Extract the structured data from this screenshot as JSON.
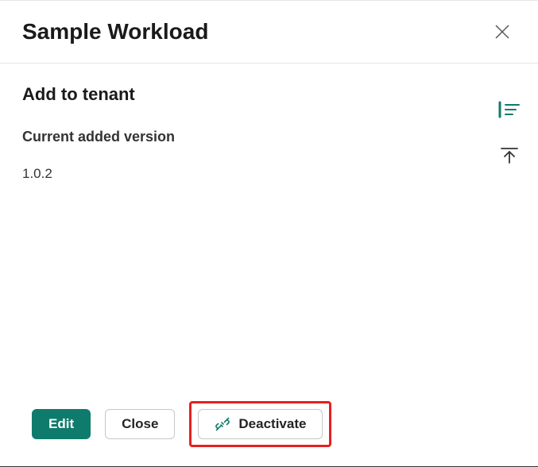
{
  "header": {
    "title": "Sample Workload"
  },
  "body": {
    "section_title": "Add to tenant",
    "version_label": "Current added version",
    "version_value": "1.0.2"
  },
  "footer": {
    "edit_label": "Edit",
    "close_label": "Close",
    "deactivate_label": "Deactivate"
  },
  "colors": {
    "primary": "#0f7b6c",
    "highlight": "#e62020"
  }
}
